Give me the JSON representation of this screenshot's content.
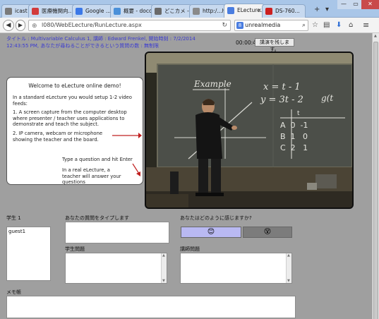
{
  "browser": {
    "tabs": [
      {
        "label": "icast (...",
        "icon_color": "#7a7a7a"
      },
      {
        "label": "医療機関向...",
        "icon_color": "#d23b3b"
      },
      {
        "label": "Google ...",
        "icon_color": "#3b78e7"
      },
      {
        "label": "概要 - doco...",
        "icon_color": "#4a90d9"
      },
      {
        "label": "どこカメ - d...",
        "icon_color": "#6a6a6a"
      },
      {
        "label": "http:/...html",
        "icon_color": "#8a8a8a"
      },
      {
        "label": "ELecture...",
        "icon_color": "#4a7de0",
        "active": true
      },
      {
        "label": "DS-760...",
        "icon_color": "#cc2020"
      }
    ],
    "close_glyph": "×",
    "new_tab_glyph": "+",
    "tab_menu_glyph": "▾",
    "window_buttons": [
      "—",
      "▭",
      "✕"
    ],
    "url": "l080/WebELecture/RunLecture.aspx",
    "search_engine_badge": "8",
    "search_text": "unrealmedia"
  },
  "page": {
    "info_line": "タイトル : Multivariable Calculus 1, 講師 : Edward Frenkel, 開始時刻 : 7/2/2014 12:43:55 PM, あなたが尋ねることができるという質問の数 : 無制限",
    "timer": "00:00:40",
    "leave_button": "講演を残します。",
    "demo": {
      "title": "Welcome to eLecture online demo!",
      "p1": "In a standard eLecture you would setup 1-2 video feeds:",
      "p2": "1. A screen capture from the computer desktop where presenter / teacher uses applications to demonstrate and teach the subject.",
      "p3": "2. IP camera, webcam or microphone showing the teacher and the board.",
      "p4": "Type a question and hit Enter",
      "p5": "In a real eLecture, a teacher will answer your questions"
    },
    "students_label": "学生 1",
    "students": [
      "guest1"
    ],
    "question_label": "あなたの質問をタイプします",
    "student_questions_label": "学生問題",
    "lecturer_questions_label": "講師問題",
    "feel_label": "あなたはどのように感じますか?",
    "feel_options": [
      {
        "icon": "smiley-icon",
        "glyph": "😊",
        "bg": "#b9b9f2"
      },
      {
        "icon": "confused-icon",
        "glyph": "😵",
        "bg": "#7c7c7c"
      }
    ],
    "notes_label": "メモ帳"
  },
  "video": {
    "board_text": {
      "example": "Example",
      "eq1": "x = t - 1",
      "eq2": "y = 3t - 2",
      "eq3": "g(t",
      "table_head": "t",
      "rows": [
        "A  0  -1",
        "B  1   0",
        "C  2   1"
      ]
    }
  }
}
